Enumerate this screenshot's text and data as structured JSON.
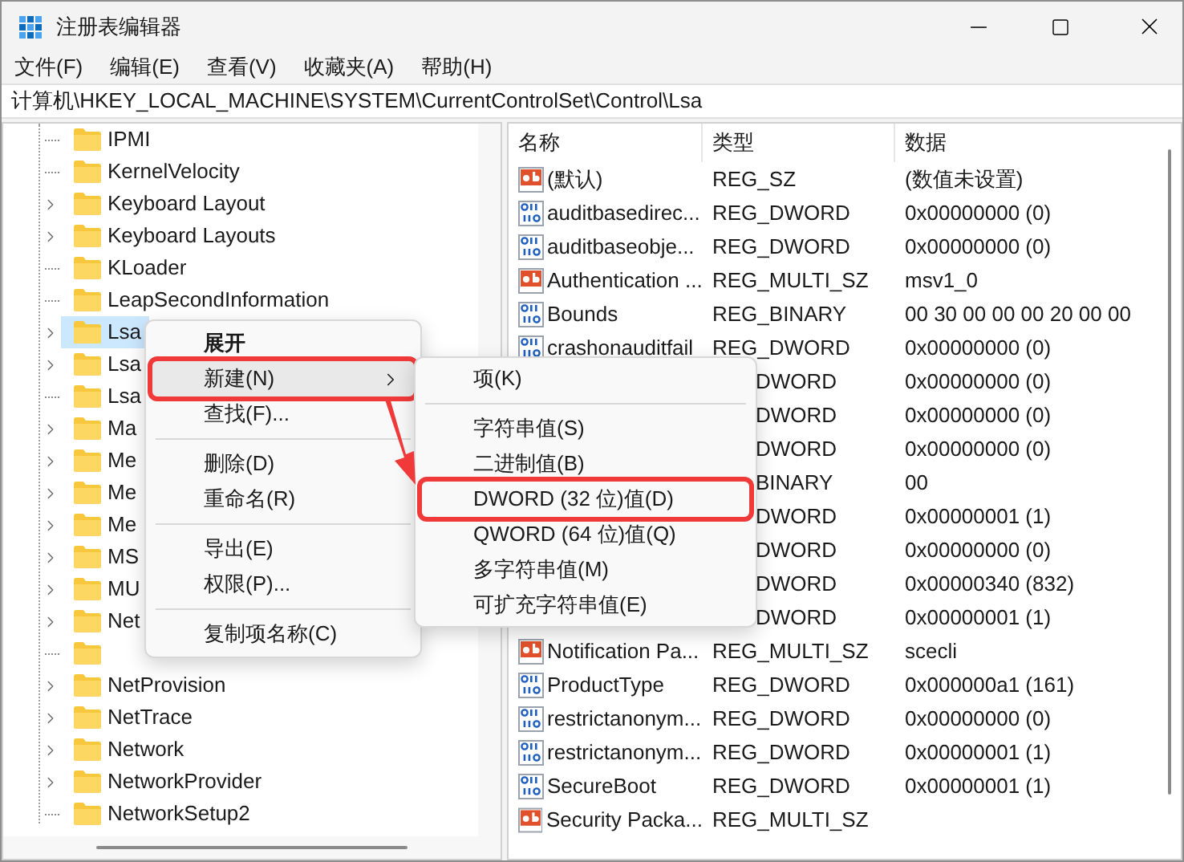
{
  "window": {
    "title": "注册表编辑器"
  },
  "menu_bar": [
    "文件(F)",
    "编辑(E)",
    "查看(V)",
    "收藏夹(A)",
    "帮助(H)"
  ],
  "address": "计算机\\HKEY_LOCAL_MACHINE\\SYSTEM\\CurrentControlSet\\Control\\Lsa",
  "tree": [
    {
      "label": "IPMI",
      "expandable": false,
      "selected": false
    },
    {
      "label": "KernelVelocity",
      "expandable": false,
      "selected": false
    },
    {
      "label": "Keyboard Layout",
      "expandable": true,
      "selected": false
    },
    {
      "label": "Keyboard Layouts",
      "expandable": true,
      "selected": false
    },
    {
      "label": "KLoader",
      "expandable": false,
      "selected": false
    },
    {
      "label": "LeapSecondInformation",
      "expandable": false,
      "selected": false
    },
    {
      "label": "Lsa",
      "expandable": true,
      "selected": true
    },
    {
      "label": "Lsa",
      "expandable": true,
      "selected": false
    },
    {
      "label": "Lsa",
      "expandable": false,
      "selected": false
    },
    {
      "label": "Ma",
      "expandable": true,
      "selected": false
    },
    {
      "label": "Me",
      "expandable": true,
      "selected": false
    },
    {
      "label": "Me",
      "expandable": true,
      "selected": false
    },
    {
      "label": "Me",
      "expandable": true,
      "selected": false
    },
    {
      "label": "MS",
      "expandable": true,
      "selected": false
    },
    {
      "label": "MU",
      "expandable": true,
      "selected": false
    },
    {
      "label": "Net",
      "expandable": true,
      "selected": false
    },
    {
      "expandable": false,
      "selected": false
    },
    {
      "label": "NetProvision",
      "expandable": true,
      "selected": false
    },
    {
      "label": "NetTrace",
      "expandable": true,
      "selected": false
    },
    {
      "label": "Network",
      "expandable": true,
      "selected": false
    },
    {
      "label": "NetworkProvider",
      "expandable": true,
      "selected": false
    },
    {
      "label": "NetworkSetup2",
      "expandable": false,
      "selected": false
    }
  ],
  "values_table": {
    "columns": [
      "名称",
      "类型",
      "数据"
    ],
    "rows": [
      {
        "kind": "string",
        "name": "(默认)",
        "type": "REG_SZ",
        "data": "(数值未设置)"
      },
      {
        "kind": "binary",
        "name": "auditbasedirec...",
        "type": "REG_DWORD",
        "data": "0x00000000 (0)"
      },
      {
        "kind": "binary",
        "name": "auditbaseobje...",
        "type": "REG_DWORD",
        "data": "0x00000000 (0)"
      },
      {
        "kind": "string",
        "name": "Authentication ...",
        "type": "REG_MULTI_SZ",
        "data": "msv1_0"
      },
      {
        "kind": "binary",
        "name": "Bounds",
        "type": "REG_BINARY",
        "data": "00 30 00 00 00 20 00 00"
      },
      {
        "kind": "binary",
        "name": "crashonauditfail",
        "type": "REG_DWORD",
        "data": "0x00000000 (0)"
      },
      {
        "kind": "covered",
        "type": "DWORD",
        "data": "0x00000000 (0)"
      },
      {
        "kind": "covered",
        "type": "DWORD",
        "data": "0x00000000 (0)"
      },
      {
        "kind": "covered",
        "type": "DWORD",
        "data": "0x00000000 (0)"
      },
      {
        "kind": "covered",
        "type": "BINARY",
        "data": "00"
      },
      {
        "kind": "covered",
        "type": "DWORD",
        "data": "0x00000001 (1)"
      },
      {
        "kind": "covered",
        "type": "DWORD",
        "data": "0x00000000 (0)"
      },
      {
        "kind": "covered",
        "type": "DWORD",
        "data": "0x00000340 (832)"
      },
      {
        "kind": "covered",
        "type": "DWORD",
        "data": "0x00000001 (1)"
      },
      {
        "kind": "string",
        "name": "Notification Pa...",
        "type": "REG_MULTI_SZ",
        "data": "scecli"
      },
      {
        "kind": "binary",
        "name": "ProductType",
        "type": "REG_DWORD",
        "data": "0x000000a1 (161)"
      },
      {
        "kind": "binary",
        "name": "restrictanonym...",
        "type": "REG_DWORD",
        "data": "0x00000000 (0)"
      },
      {
        "kind": "binary",
        "name": "restrictanonym...",
        "type": "REG_DWORD",
        "data": "0x00000001 (1)"
      },
      {
        "kind": "binary",
        "name": "SecureBoot",
        "type": "REG_DWORD",
        "data": "0x00000001 (1)"
      },
      {
        "kind": "string",
        "name": "Security Packa...",
        "type": "REG_MULTI_SZ"
      }
    ]
  },
  "context_menu": [
    {
      "kind": "item",
      "label": "展开",
      "bold": true,
      "selected": false,
      "outlined": false
    },
    {
      "kind": "item",
      "label": "新建(N)",
      "has_submenu": true,
      "selected": true,
      "outlined": true
    },
    {
      "kind": "item",
      "label": "查找(F)...",
      "selected": false,
      "outlined": false
    },
    {
      "kind": "separator"
    },
    {
      "kind": "item",
      "label": "删除(D)",
      "selected": false,
      "outlined": false
    },
    {
      "kind": "item",
      "label": "重命名(R)",
      "selected": false,
      "outlined": false
    },
    {
      "kind": "separator"
    },
    {
      "kind": "item",
      "label": "导出(E)",
      "selected": false,
      "outlined": false
    },
    {
      "kind": "item",
      "label": "权限(P)...",
      "selected": false,
      "outlined": false
    },
    {
      "kind": "separator"
    },
    {
      "kind": "item",
      "label": "复制项名称(C)",
      "selected": false,
      "outlined": false
    }
  ],
  "submenu": [
    {
      "kind": "item",
      "label": "项(K)",
      "selected": false,
      "outlined": false
    },
    {
      "kind": "separator"
    },
    {
      "kind": "item",
      "label": "字符串值(S)",
      "selected": false,
      "outlined": false
    },
    {
      "kind": "item",
      "label": "二进制值(B)",
      "selected": false,
      "outlined": false
    },
    {
      "kind": "item",
      "label": "DWORD (32 位)值(D)",
      "selected": false,
      "outlined": true
    },
    {
      "kind": "item",
      "label": "QWORD (64 位)值(Q)",
      "selected": false,
      "outlined": false
    },
    {
      "kind": "item",
      "label": "多字符串值(M)",
      "selected": false,
      "outlined": false
    },
    {
      "kind": "item",
      "label": "可扩充字符串值(E)",
      "selected": false,
      "outlined": false
    }
  ]
}
